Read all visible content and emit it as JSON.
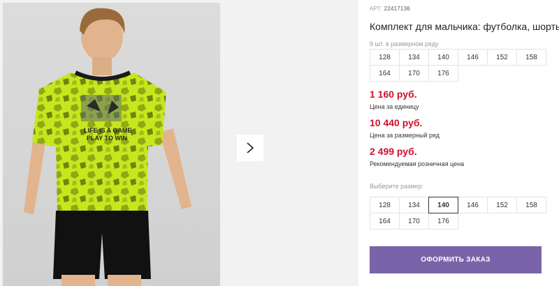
{
  "product": {
    "sku_label": "АРТ:",
    "sku_value": "22417136",
    "title": "Комплект для мальчика: футболка, шорты"
  },
  "size_row": {
    "label": "9 шт. в размерном ряду",
    "sizes": [
      "128",
      "134",
      "140",
      "146",
      "152",
      "158",
      "164",
      "170",
      "176"
    ]
  },
  "prices": [
    {
      "value": "1 160 руб.",
      "note": "Цена за единицу"
    },
    {
      "value": "10 440 руб.",
      "note": "Цена за размерный ряд"
    },
    {
      "value": "2 499 руб.",
      "note": "Рекомендуемая розничная цена"
    }
  ],
  "size_select": {
    "label": "Выберите размер:",
    "sizes": [
      "128",
      "134",
      "140",
      "146",
      "152",
      "158",
      "164",
      "170",
      "176"
    ],
    "selected": "140"
  },
  "order_button": {
    "label": "ОФОРМИТЬ ЗАКАЗ"
  },
  "photo": {
    "shirt_print_line1": "LIFE IS A GAME",
    "shirt_print_line2": "PLAY TO WIN"
  },
  "colors": {
    "price": "#d2102a",
    "order_button": "#7a63a8",
    "shirt": "#c8e61e",
    "shorts": "#111111"
  },
  "icons": {
    "next": "chevron-right-icon"
  }
}
